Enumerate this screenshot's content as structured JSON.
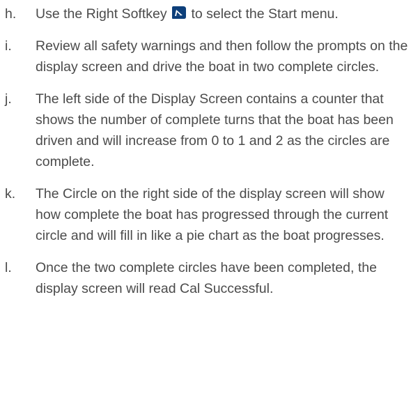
{
  "steps": [
    {
      "letter": "h.",
      "text_before": "Use the Right Softkey ",
      "icon": "right-softkey-icon",
      "text_after": " to select the Start menu."
    },
    {
      "letter": "i.",
      "text": "Review all safety warnings and then follow the prompts on the display screen and drive the boat in two complete circles."
    },
    {
      "letter": "j.",
      "text": "The left side of the Display Screen contains a counter that shows the number of complete turns that the boat has been driven and will increase from 0 to 1 and 2 as the circles are complete."
    },
    {
      "letter": "k.",
      "text": "The Circle on the right side of the display screen will show how complete the boat has progressed through the current circle and will fill in like a pie chart as the boat progresses."
    },
    {
      "letter": "l.",
      "text": "Once the two complete circles have been completed, the display screen will read Cal Successful."
    }
  ],
  "colors": {
    "text": "#4b4b4b",
    "icon_fill": "#0d3f7a",
    "icon_accent": "#ffffff"
  }
}
